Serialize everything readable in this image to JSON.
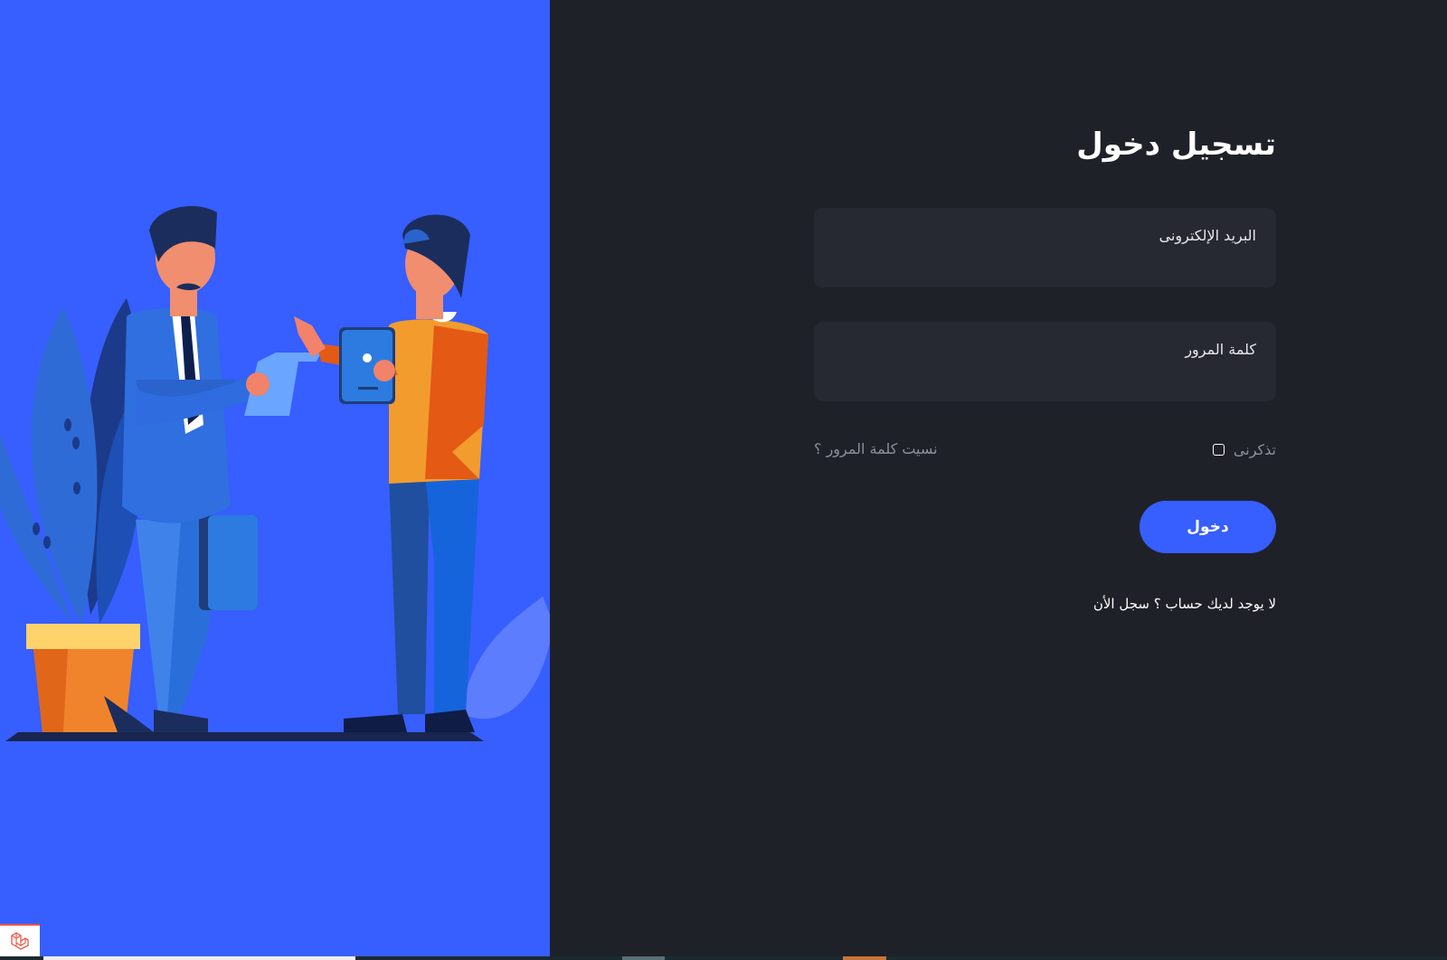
{
  "login": {
    "title": "تسجيل دخول",
    "email_placeholder": "البريد الإلكترونى",
    "password_placeholder": "كلمة المرور",
    "remember_label": "تذكرنى",
    "forgot_label": "نسيت كلمة المرور ؟",
    "submit_label": "دخول",
    "signup_text": "لا يوجد لديك حساب ؟ سجل الأن"
  },
  "illustration": {
    "description_icon": "business-handshake-illustration-icon"
  },
  "badge": {
    "icon": "laravel-logo-icon"
  },
  "colors": {
    "accent": "#375efe",
    "background": "#1f2129",
    "input_background": "#262932",
    "muted_text": "#8d909a"
  }
}
